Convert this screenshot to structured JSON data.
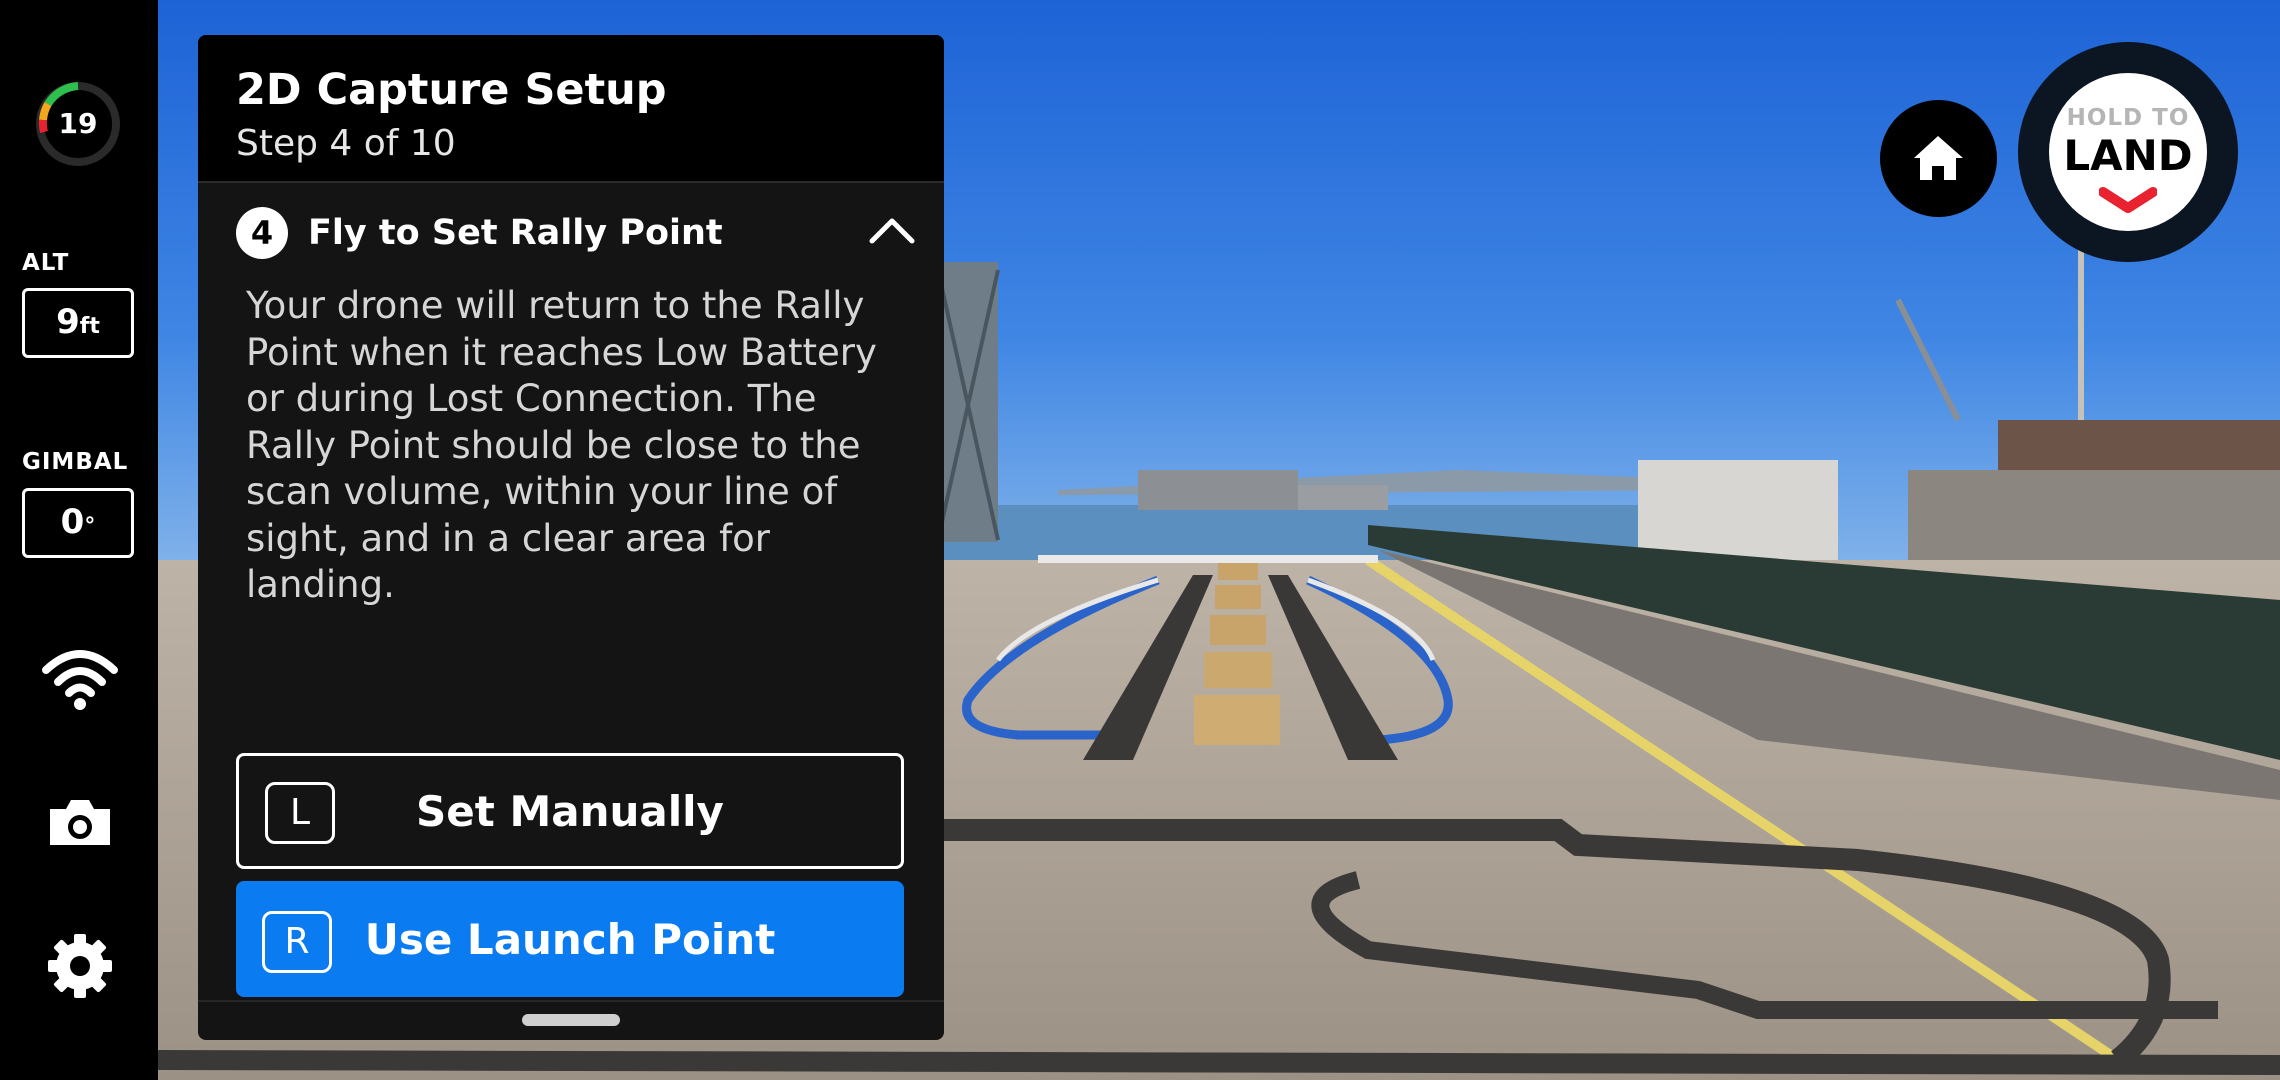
{
  "rail": {
    "battery_percent": "19",
    "alt_label": "ALT",
    "alt_value": "9",
    "alt_unit": "ft",
    "gimbal_label": "GIMBAL",
    "gimbal_value": "0",
    "gimbal_unit": "°",
    "icons": [
      "wifi-icon",
      "camera-icon",
      "gear-icon"
    ]
  },
  "panel": {
    "title": "2D Capture Setup",
    "subtitle": "Step 4 of 10",
    "step_number": "4",
    "step_title": "Fly to Set Rally Point",
    "description": "Your drone will return to the Rally Point when it reaches Low Battery or during Lost Connection. The Rally Point should be close to the scan volume, within your line of sight, and in a clear area for landing.",
    "buttons": {
      "manual_key": "L",
      "manual_label": "Set Manually",
      "launch_key": "R",
      "launch_label": "Use Launch Point"
    }
  },
  "controls": {
    "hold_text": "HOLD TO",
    "land_text": "LAND"
  },
  "colors": {
    "accent_blue": "#0a7bf0",
    "land_chevron": "#e8232f",
    "battery_arc": "#2fbf4f"
  }
}
